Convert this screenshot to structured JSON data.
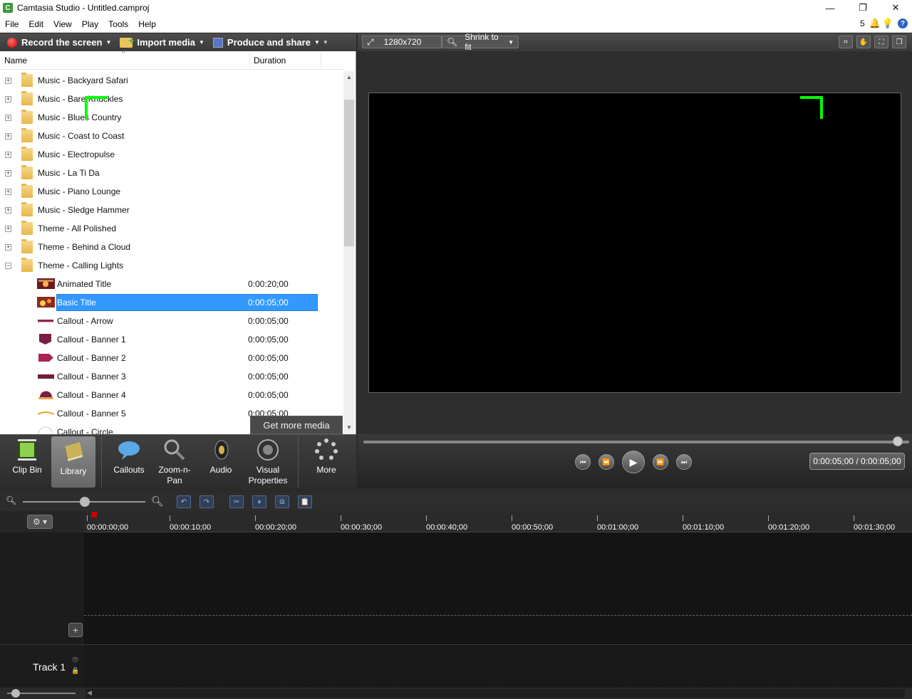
{
  "window": {
    "title": "Camtasia Studio - Untitled.camproj",
    "minimize": "—",
    "maximize": "❐",
    "close": "✕"
  },
  "menu": [
    "File",
    "Edit",
    "View",
    "Play",
    "Tools",
    "Help"
  ],
  "notifications": {
    "count": "5"
  },
  "toolbar": {
    "record_label": "Record the screen",
    "import_label": "Import media",
    "produce_label": "Produce and share"
  },
  "library": {
    "col_name": "Name",
    "col_duration": "Duration",
    "folders": [
      "Music - Backyard Safari",
      "Music - Bare Knuckles",
      "Music - Blues Country",
      "Music - Coast to Coast",
      "Music - Electropulse",
      "Music - La Ti Da",
      "Music - Piano Lounge",
      "Music - Sledge Hammer",
      "Theme - All Polished",
      "Theme - Behind a Cloud",
      "Theme - Calling Lights"
    ],
    "children": [
      {
        "label": "Animated Title",
        "duration": "0:00:20;00"
      },
      {
        "label": "Basic Title",
        "duration": "0:00:05;00",
        "selected": true
      },
      {
        "label": "Callout - Arrow",
        "duration": "0:00:05;00"
      },
      {
        "label": "Callout - Banner 1",
        "duration": "0:00:05;00"
      },
      {
        "label": "Callout - Banner 2",
        "duration": "0:00:05;00"
      },
      {
        "label": "Callout - Banner 3",
        "duration": "0:00:05;00"
      },
      {
        "label": "Callout - Banner 4",
        "duration": "0:00:05;00"
      },
      {
        "label": "Callout - Banner 5",
        "duration": "0:00:05;00"
      },
      {
        "label": "Callout - Circle",
        "duration": ""
      }
    ],
    "get_more": "Get more media"
  },
  "tasks": {
    "clip_bin": "Clip Bin",
    "library": "Library",
    "callouts": "Callouts",
    "zoom_pan": "Zoom-n-\nPan",
    "audio": "Audio",
    "visual": "Visual\nProperties",
    "more": "More"
  },
  "preview": {
    "dimensions": "1280x720",
    "zoom": "Shrink to fit",
    "time": "0:00:05;00 / 0:00:05;00",
    "corner_color": "#00ff00"
  },
  "timeline": {
    "ticks": [
      "00:00:00;00",
      "00:00:10;00",
      "00:00:20;00",
      "00:00:30;00",
      "00:00:40;00",
      "00:00:50;00",
      "00:01:00;00",
      "00:01:10;00",
      "00:01:20;00",
      "00:01:30;00"
    ],
    "track_name": "Track 1"
  },
  "colors": {
    "selection": "#3399ff",
    "accent_green": "#00ff00"
  }
}
